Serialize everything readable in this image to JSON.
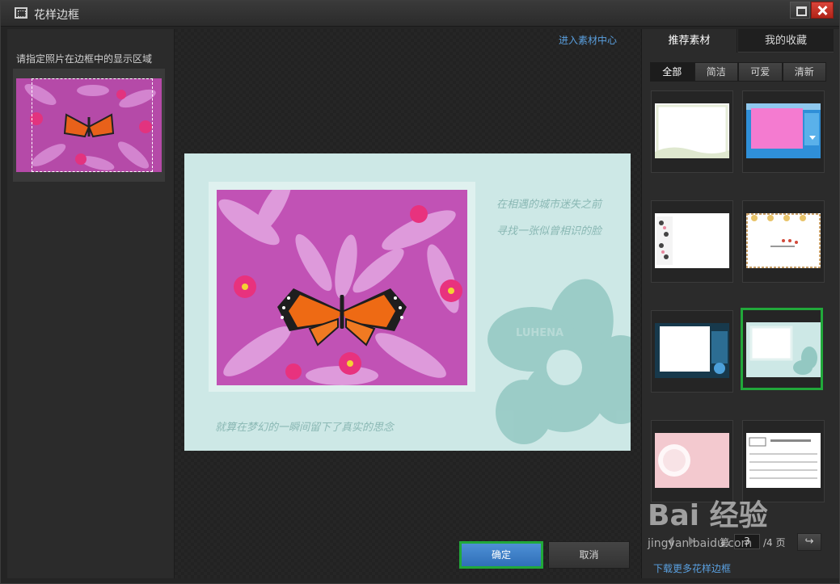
{
  "window": {
    "title": "花样边框"
  },
  "left": {
    "instruction": "请指定照片在边框中的显示区域"
  },
  "center": {
    "link": "进入素材中心",
    "verse1": "在相遇的城市迷失之前",
    "verse2": "寻找一张似曾相识的脸",
    "verse3": "就算在梦幻的一瞬间留下了真实的思念",
    "watermark": "LUHENA",
    "ok_label": "确定",
    "cancel_label": "取消"
  },
  "right": {
    "tabs": [
      {
        "label": "推荐素材"
      },
      {
        "label": "我的收藏"
      }
    ],
    "filters": [
      {
        "label": "全部"
      },
      {
        "label": "简洁"
      },
      {
        "label": "可爱"
      },
      {
        "label": "清新"
      }
    ],
    "pager": {
      "prefix": "第",
      "current": "3",
      "suffix": "/4 页",
      "go_icon": "↪"
    },
    "download_link": "下载更多花样边框"
  },
  "overlay": {
    "brand": "Bai 经验",
    "url": "jingyan.baidu.com"
  },
  "colors": {
    "accent_blue": "#5aa0e0",
    "select_green": "#21a83a",
    "preview_bg": "#cde8e6"
  }
}
